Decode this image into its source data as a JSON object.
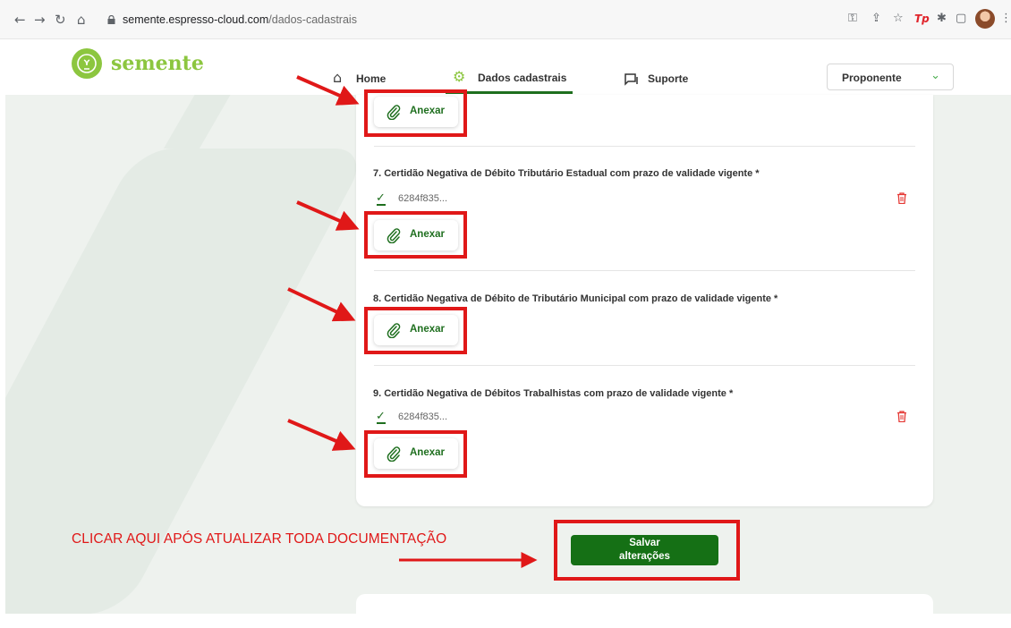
{
  "browser": {
    "url_host": "semente.espresso-cloud.com",
    "url_path": "/dados-cadastrais",
    "ext_tp": "Tp"
  },
  "header": {
    "logo_text": "semente",
    "nav": [
      {
        "label": "Home",
        "icon": "home-icon"
      },
      {
        "label": "Dados cadastrais",
        "icon": "gear-icon"
      },
      {
        "label": "Suporte",
        "icon": "chat-icon"
      }
    ],
    "role_select": {
      "value": "Proponente"
    }
  },
  "documents": [
    {
      "title": "7. Certidão Negativa de Débito Tributário Estadual com prazo de validade vigente *",
      "file": "6284f835..."
    },
    {
      "title": "8. Certidão Negativa de Débito de Tributário Municipal com prazo de validade vigente *"
    },
    {
      "title": "9. Certidão Negativa de Débitos Trabalhistas com prazo de validade vigente *",
      "file": "6284f835..."
    }
  ],
  "attach_label": "Anexar",
  "instruction": "CLICAR AQUI APÓS ATUALIZAR TODA DOCUMENTAÇÃO",
  "save_button": {
    "line1": "Salvar",
    "line2": "alterações"
  },
  "colors": {
    "accent": "#1f6f1f",
    "brand": "#8cc63f",
    "annotation": "#e01818",
    "delete": "#e53935"
  }
}
